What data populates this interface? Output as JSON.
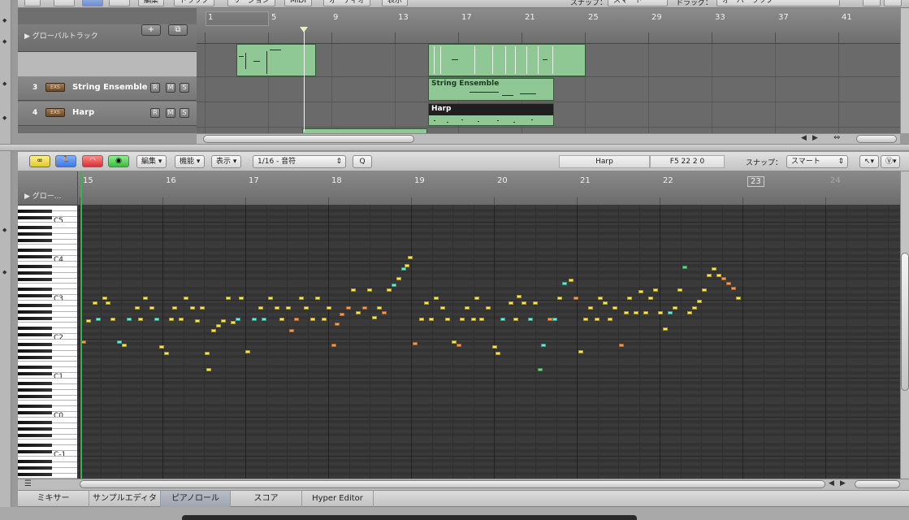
{
  "arrange": {
    "toolbar": {
      "items": [
        "編集",
        "トラック",
        "リージョン",
        "MIDI",
        "オーディオ",
        "表示"
      ],
      "snap_label": "スナップ：",
      "snap_value": "スマート",
      "drag_label": "ドラッグ：",
      "drag_value": "オーバーラップ"
    },
    "global_tracks_label": "▶ グローバルトラック",
    "add_track_symbol": "+",
    "ruler_bars": [
      "1",
      "5",
      "9",
      "13",
      "17",
      "21",
      "25",
      "29",
      "33",
      "37",
      "41"
    ],
    "tracks": [
      {
        "number": "3",
        "name": "String Ensemble",
        "instrument": "EXS"
      },
      {
        "number": "4",
        "name": "Harp",
        "instrument": "EXS"
      }
    ],
    "track_buttons": {
      "record": "R",
      "mute": "M",
      "solo": "S"
    },
    "regions": [
      {
        "name": "String Ensemble"
      },
      {
        "name": "Harp"
      }
    ]
  },
  "piano_roll": {
    "toolbar": {
      "menus": [
        "編集",
        "機能",
        "表示"
      ],
      "quantize_value": "1/16 - 音符",
      "q_button": "Q",
      "region_name": "Harp",
      "position_readout": "F5   22 2  0",
      "snap_label": "スナップ：",
      "snap_value": "スマート"
    },
    "global_tracks_label": "▶ グロー...",
    "ruler_bars": [
      "15",
      "16",
      "17",
      "18",
      "19",
      "20",
      "21",
      "22",
      "23",
      "24"
    ],
    "octave_labels": [
      "C5",
      "C4",
      "C3",
      "C2",
      "C1",
      "C0",
      "C-1"
    ],
    "note_colors": {
      "yellow": "#ffe94a",
      "cyan": "#5ff2d4",
      "orange": "#ff9a4a",
      "green": "#5ee07a"
    }
  },
  "tabs": [
    "ミキサー",
    "サンプルエディタ",
    "ピアノロール",
    "スコア",
    "Hyper Editor"
  ],
  "active_tab": "ピアノロール"
}
